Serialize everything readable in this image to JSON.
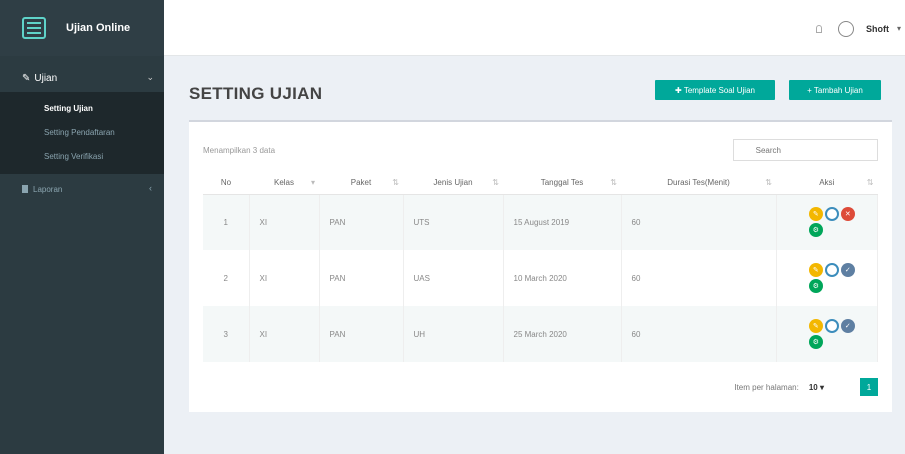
{
  "app": {
    "name": "Ujian Online"
  },
  "sidebar": {
    "menu": {
      "label": "Ujian",
      "items": [
        {
          "label": "Setting Ujian",
          "active": true
        },
        {
          "label": "Setting Pendaftaran",
          "active": false
        },
        {
          "label": "Setting Verifikasi",
          "active": false
        }
      ]
    },
    "laporan_label": "Laporan"
  },
  "topbar": {
    "user": "Shoft"
  },
  "page": {
    "title": "SETTING UJIAN"
  },
  "buttons": {
    "template": "✚ Template Soal Ujian",
    "tambah": "+ Tambah Ujian"
  },
  "table": {
    "show_text": "Menampilkan 3 data",
    "search_placeholder": "Search",
    "columns": [
      "No",
      "Kelas",
      "Paket",
      "Jenis Ujian",
      "Tanggal Tes",
      "Durasi Tes(Menit)",
      "Aksi"
    ],
    "rows": [
      {
        "no": "1",
        "kelas": "XI",
        "paket": "PAN",
        "jenis": "UTS",
        "tanggal": "15 August 2019",
        "durasi": "60"
      },
      {
        "no": "2",
        "kelas": "XI",
        "paket": "PAN",
        "jenis": "UAS",
        "tanggal": "10 March 2020",
        "durasi": "60"
      },
      {
        "no": "3",
        "kelas": "XI",
        "paket": "PAN",
        "jenis": "UH",
        "tanggal": "25 March 2020",
        "durasi": "60"
      }
    ],
    "items_per_page_label": "Item per halaman:",
    "items_per_page": "10",
    "current_page": "1"
  },
  "colors": {
    "sidebar": "#2c3b41",
    "accent": "#00a89a",
    "edit": "#f3b700",
    "view": "#3c8dbc",
    "delete": "#dd4b39",
    "done": "#5e7fa2",
    "extra": "#00a65a"
  }
}
